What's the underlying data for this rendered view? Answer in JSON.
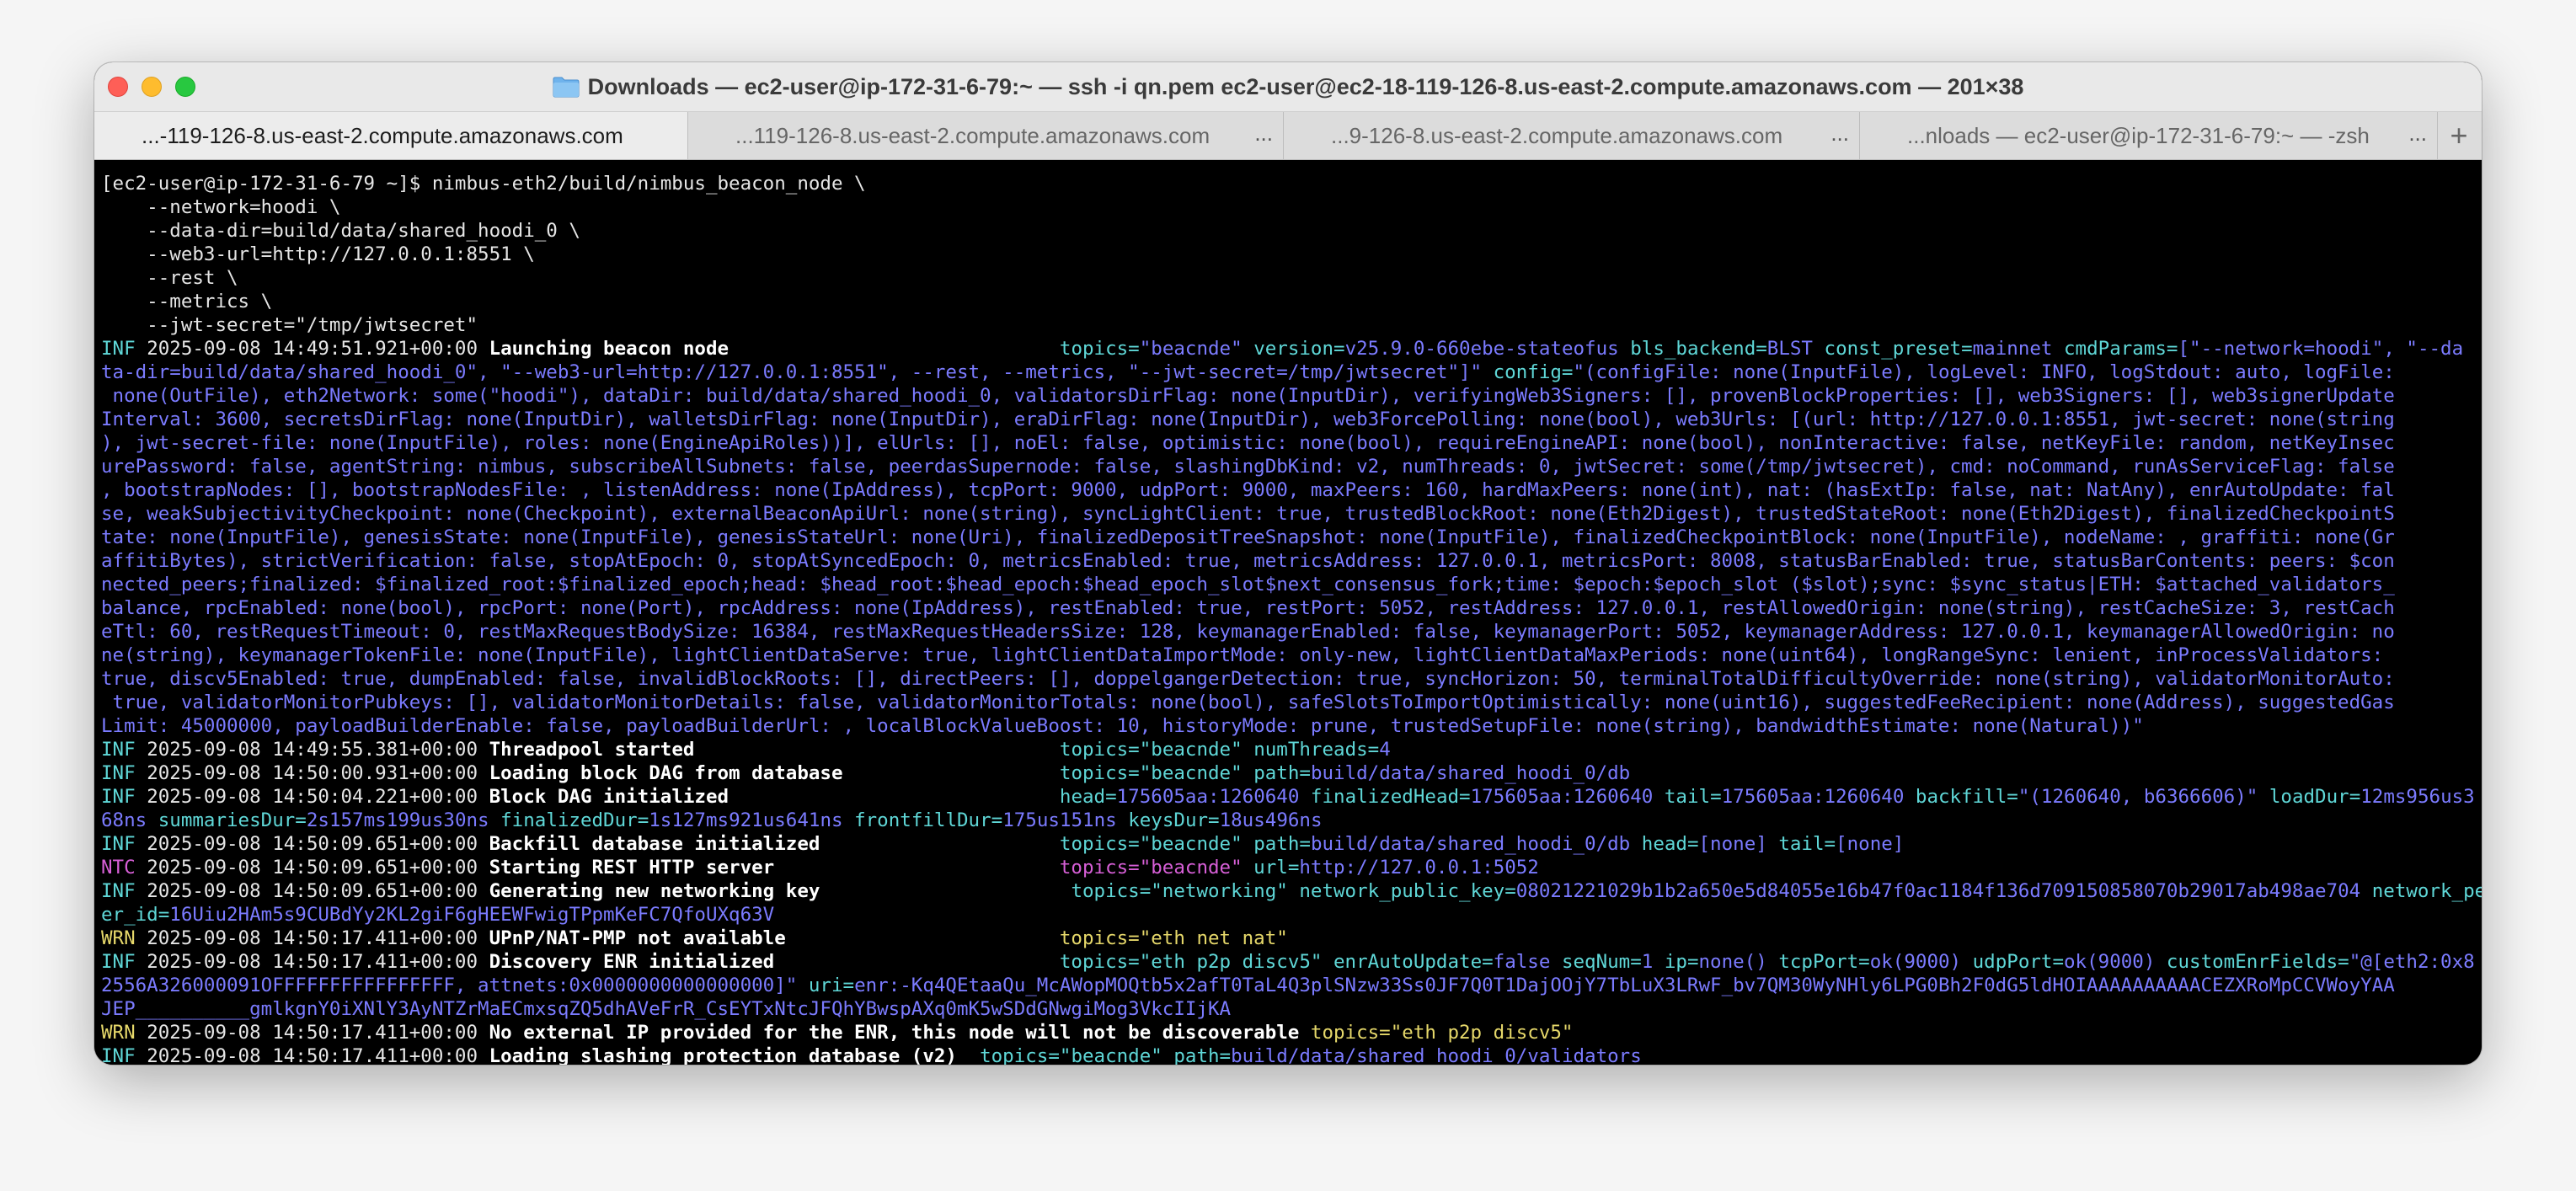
{
  "window": {
    "title": "Downloads — ec2-user@ip-172-31-6-79:~ — ssh -i qn.pem ec2-user@ec2-18-119-126-8.us-east-2.compute.amazonaws.com — 201×38"
  },
  "tabs": [
    {
      "label": "...-119-126-8.us-east-2.compute.amazonaws.com",
      "active": true
    },
    {
      "label": "...119-126-8.us-east-2.compute.amazonaws.com",
      "active": false
    },
    {
      "label": "...9-126-8.us-east-2.compute.amazonaws.com",
      "active": false
    },
    {
      "label": "...nloads — ec2-user@ip-172-31-6-79:~ — -zsh",
      "active": false
    }
  ],
  "tab_overflow": "...",
  "new_tab": "+",
  "terminal": {
    "command": [
      "[ec2-user@ip-172-31-6-79 ~]$ nimbus-eth2/build/nimbus_beacon_node \\",
      "    --network=hoodi \\",
      "    --data-dir=build/data/shared_hoodi_0 \\",
      "    --web3-url=http://127.0.0.1:8551 \\",
      "    --rest \\",
      "    --metrics \\",
      "    --jwt-secret=\"/tmp/jwtsecret\""
    ],
    "launch": {
      "level": "INF",
      "ts": "2025-09-08 14:49:51.921+00:00",
      "msg": "Launching beacon node",
      "pad": "                             ",
      "k_topics": "topics=",
      "v_topics": "\"beacnde\"",
      "k_version": " version=",
      "v_version": "v25.9.0-660ebe-stateofus",
      "k_bls": " bls_backend=",
      "v_bls": "BLST",
      "k_preset": " const_preset=",
      "v_preset": "mainnet",
      "k_cmd": " cmdParams=",
      "v_cmd_1": "[\"--network=hoodi\", \"--da",
      "cont_1_a": "ta-dir=build/data/shared_hoodi_0\", \"--web3-url=http://127.0.0.1:8551\", --rest, --metrics, \"--jwt-secret=/tmp/jwtsecret\"]\"",
      "k_config": " config=",
      "v_config_1": "\"(configFile: none(InputFile), logLevel: INFO, logStdout: auto, logFile:",
      "wrap": [
        " none(OutFile), eth2Network: some(\"hoodi\"), dataDir: build/data/shared_hoodi_0, validatorsDirFlag: none(InputDir), verifyingWeb3Signers: [], provenBlockProperties: [], web3Signers: [], web3signerUpdate",
        "Interval: 3600, secretsDirFlag: none(InputDir), walletsDirFlag: none(InputDir), eraDirFlag: none(InputDir), web3ForcePolling: none(bool), web3Urls: [(url: http://127.0.0.1:8551, jwt-secret: none(string",
        "), jwt-secret-file: none(InputFile), roles: none(EngineApiRoles))], elUrls: [], noEl: false, optimistic: none(bool), requireEngineAPI: none(bool), nonInteractive: false, netKeyFile: random, netKeyInsec",
        "urePassword: false, agentString: nimbus, subscribeAllSubnets: false, peerdasSupernode: false, slashingDbKind: v2, numThreads: 0, jwtSecret: some(/tmp/jwtsecret), cmd: noCommand, runAsServiceFlag: false",
        ", bootstrapNodes: [], bootstrapNodesFile: , listenAddress: none(IpAddress), tcpPort: 9000, udpPort: 9000, maxPeers: 160, hardMaxPeers: none(int), nat: (hasExtIp: false, nat: NatAny), enrAutoUpdate: fal",
        "se, weakSubjectivityCheckpoint: none(Checkpoint), externalBeaconApiUrl: none(string), syncLightClient: true, trustedBlockRoot: none(Eth2Digest), trustedStateRoot: none(Eth2Digest), finalizedCheckpointS",
        "tate: none(InputFile), genesisState: none(InputFile), genesisStateUrl: none(Uri), finalizedDepositTreeSnapshot: none(InputFile), finalizedCheckpointBlock: none(InputFile), nodeName: , graffiti: none(Gr",
        "affitiBytes), strictVerification: false, stopAtEpoch: 0, stopAtSyncedEpoch: 0, metricsEnabled: true, metricsAddress: 127.0.0.1, metricsPort: 8008, statusBarEnabled: true, statusBarContents: peers: $con",
        "nected_peers;finalized: $finalized_root:$finalized_epoch;head: $head_root:$head_epoch:$head_epoch_slot$next_consensus_fork;time: $epoch:$epoch_slot ($slot);sync: $sync_status|ETH: $attached_validators_",
        "balance, rpcEnabled: none(bool), rpcPort: none(Port), rpcAddress: none(IpAddress), restEnabled: true, restPort: 5052, restAddress: 127.0.0.1, restAllowedOrigin: none(string), restCacheSize: 3, restCach",
        "eTtl: 60, restRequestTimeout: 0, restMaxRequestBodySize: 16384, restMaxRequestHeadersSize: 128, keymanagerEnabled: false, keymanagerPort: 5052, keymanagerAddress: 127.0.0.1, keymanagerAllowedOrigin: no",
        "ne(string), keymanagerTokenFile: none(InputFile), lightClientDataServe: true, lightClientDataImportMode: only-new, lightClientDataMaxPeriods: none(uint64), longRangeSync: lenient, inProcessValidators:",
        "true, discv5Enabled: true, dumpEnabled: false, invalidBlockRoots: [], directPeers: [], doppelgangerDetection: true, syncHorizon: 50, terminalTotalDifficultyOverride: none(string), validatorMonitorAuto:",
        " true, validatorMonitorPubkeys: [], validatorMonitorDetails: false, validatorMonitorTotals: none(bool), safeSlotsToImportOptimistically: none(uint16), suggestedFeeRecipient: none(Address), suggestedGas",
        "Limit: 45000000, payloadBuilderEnable: false, payloadBuilderUrl: , localBlockValueBoost: 10, historyMode: prune, trustedSetupFile: none(string), bandwidthEstimate: none(Natural))\""
      ]
    },
    "log": [
      {
        "level": "INF",
        "ts": "2025-09-08 14:49:55.381+00:00",
        "msg": "Threadpool started",
        "pad": "                                ",
        "kv": [
          [
            "topics=",
            "\"beacnde\""
          ],
          [
            " numThreads=",
            "4"
          ]
        ]
      },
      {
        "level": "INF",
        "ts": "2025-09-08 14:50:00.931+00:00",
        "msg": "Loading block DAG from database",
        "pad": "                   ",
        "kv": [
          [
            "topics=",
            "\"beacnde\""
          ],
          [
            " path=",
            "build/data/shared_hoodi_0/db"
          ]
        ]
      },
      {
        "level": "INF",
        "ts": "2025-09-08 14:50:04.221+00:00",
        "msg": "Block DAG initialized",
        "pad": "                             ",
        "kv": [
          [
            "head=",
            "175605aa:1260640"
          ],
          [
            " finalizedHead=",
            "175605aa:1260640"
          ],
          [
            " tail=",
            "175605aa:1260640"
          ],
          [
            " backfill=",
            "\"(1260640, b6366606)\""
          ],
          [
            " loadDur=",
            "12ms956us3"
          ]
        ],
        "wrap": [
          [
            "",
            "68ns"
          ],
          [
            " summariesDur=",
            "2s157ms199us30ns"
          ],
          [
            " finalizedDur=",
            "1s127ms921us641ns"
          ],
          [
            " frontfillDur=",
            "175us151ns"
          ],
          [
            " keysDur=",
            "18us496ns"
          ]
        ]
      },
      {
        "level": "INF",
        "ts": "2025-09-08 14:50:09.651+00:00",
        "msg": "Backfill database initialized",
        "pad": "                     ",
        "kv": [
          [
            "topics=",
            "\"beacnde\""
          ],
          [
            " path=",
            "build/data/shared_hoodi_0/db"
          ],
          [
            " head=",
            "[none]"
          ],
          [
            " tail=",
            "[none]"
          ]
        ]
      },
      {
        "level": "NTC",
        "ts": "2025-09-08 14:50:09.651+00:00",
        "msg": "Starting REST HTTP server",
        "pad": "                         ",
        "kv": [
          [
            "topics=",
            "\"beacnde\""
          ],
          [
            " url=",
            "http://127.0.0.1:5052"
          ]
        ]
      },
      {
        "level": "INF",
        "ts": "2025-09-08 14:50:09.651+00:00",
        "msg": "Generating new networking key",
        "pad": "                      ",
        "kv": [
          [
            "topics=",
            "\"networking\""
          ],
          [
            " network_public_key=",
            "08021221029b1b2a650e5d84055e16b47f0ac1184f136d709150858070b29017ab498ae704"
          ],
          [
            " network_pe",
            ""
          ]
        ],
        "wrap": [
          [
            "er_id=",
            "16Uiu2HAm5s9CUBdYy2KL2giF6gHEEWFwigTPpmKeFC7QfoUXq63V"
          ]
        ]
      },
      {
        "level": "WRN",
        "ts": "2025-09-08 14:50:17.411+00:00",
        "msg": "UPnP/NAT-PMP not available",
        "pad": "                        ",
        "kv": [
          [
            "topics=",
            "\"eth net nat\""
          ]
        ]
      },
      {
        "level": "INF",
        "ts": "2025-09-08 14:50:17.411+00:00",
        "msg": "Discovery ENR initialized",
        "pad": "                         ",
        "kv": [
          [
            "topics=",
            "\"eth p2p discv5\""
          ],
          [
            " enrAutoUpdate=",
            "false"
          ],
          [
            " seqNum=",
            "1"
          ],
          [
            " ip=",
            "none()"
          ],
          [
            " tcpPort=",
            "ok(9000)"
          ],
          [
            " udpPort=",
            "ok(9000)"
          ],
          [
            " customEnrFields=",
            "\"@[eth2:0x8"
          ]
        ],
        "wrap": [
          [
            "",
            "2556A326000091OFFFFFFFFFFFFFFFF, attnets:0x0000000000000000]\""
          ],
          [
            " uri=",
            "enr:-Kq4QEtaaQu_McAWopMOQtb5x2afT0TaL4Q3plSNzw33Ss0JF7Q0T1DajOOjY7TbLuX3LRwF_bv7QM30WyNHly6LPG0Bh2F0dG5ldHOIAAAAAAAAAACEZXRoMpCCVWoyYAA"
          ]
        ],
        "wrap2": "JEP__________gmlkgnY0iXNlY3AyNTZrMaECmxsqZQ5dhAVeFrR_CsEYTxNtcJFQhYBwspAXq0mK5wSDdGNwgiMog3VkcIIjKA"
      },
      {
        "level": "WRN",
        "ts": "2025-09-08 14:50:17.411+00:00",
        "msg": "No external IP provided for the ENR, this node will not be discoverable",
        "pad": " ",
        "kv": [
          [
            "topics=",
            "\"eth p2p discv5\""
          ]
        ]
      },
      {
        "level": "INF",
        "ts": "2025-09-08 14:50:17.411+00:00",
        "msg": "Loading slashing protection database (v2)",
        "pad": "  ",
        "kv": [
          [
            "topics=",
            "\"beacnde\""
          ],
          [
            " path=",
            "build/data/shared_hoodi_0/validators"
          ]
        ]
      }
    ]
  }
}
